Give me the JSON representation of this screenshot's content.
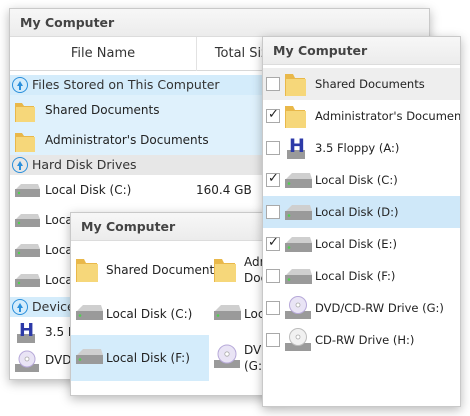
{
  "windows": {
    "details": {
      "title": "My Computer",
      "columns": {
        "name": "File Name",
        "size": "Total Size"
      },
      "groups": {
        "stored": "Files Stored on This Computer",
        "hdd": "Hard Disk Drives",
        "removable": "Devices with Removable Storage"
      },
      "rows": {
        "shared": "Shared Documents",
        "admin": "Administrator's Documents",
        "c": {
          "name": "Local Disk (C:)",
          "size": "160.4 GB"
        },
        "d": "Local Disk (D:)",
        "e": "Local Disk (E:)",
        "f": "Local Disk (F:)",
        "floppy": "3.5 Floppy (A:)",
        "dvd": "DVD/CD-RW Drive (G:)"
      }
    },
    "icons": {
      "title": "My Computer",
      "tiles": {
        "shared": "Shared Documents",
        "admin_line1": "Administrator's",
        "admin_line2": "Documents",
        "c": "Local Disk (C:)",
        "d": "Local Disk (D:)",
        "f": "Local Disk (F:)",
        "dvd_line1": "DVD/CD-RW Drive",
        "dvd_line2": "(G:)"
      }
    },
    "checklist": {
      "title": "My Computer",
      "items": [
        {
          "label": "Shared Documents",
          "checked": false,
          "icon": "folder-icon"
        },
        {
          "label": "Administrator's Documents",
          "checked": true,
          "icon": "folder-icon"
        },
        {
          "label": "3.5 Floppy (A:)",
          "checked": false,
          "icon": "floppy-icon"
        },
        {
          "label": "Local Disk (C:)",
          "checked": true,
          "icon": "hard-disk-icon"
        },
        {
          "label": "Local Disk (D:)",
          "checked": false,
          "icon": "hard-disk-icon"
        },
        {
          "label": "Local Disk (E:)",
          "checked": true,
          "icon": "hard-disk-icon"
        },
        {
          "label": "Local Disk (F:)",
          "checked": false,
          "icon": "hard-disk-icon"
        },
        {
          "label": "DVD/CD-RW Drive (G:)",
          "checked": false,
          "icon": "dvd-drive-icon"
        },
        {
          "label": "CD-RW Drive (H:)",
          "checked": false,
          "icon": "cd-drive-icon"
        }
      ]
    }
  },
  "colors": {
    "selection": "#d4ecfb",
    "accent": "#2a8fdb",
    "folder": "#f3cf6b"
  }
}
